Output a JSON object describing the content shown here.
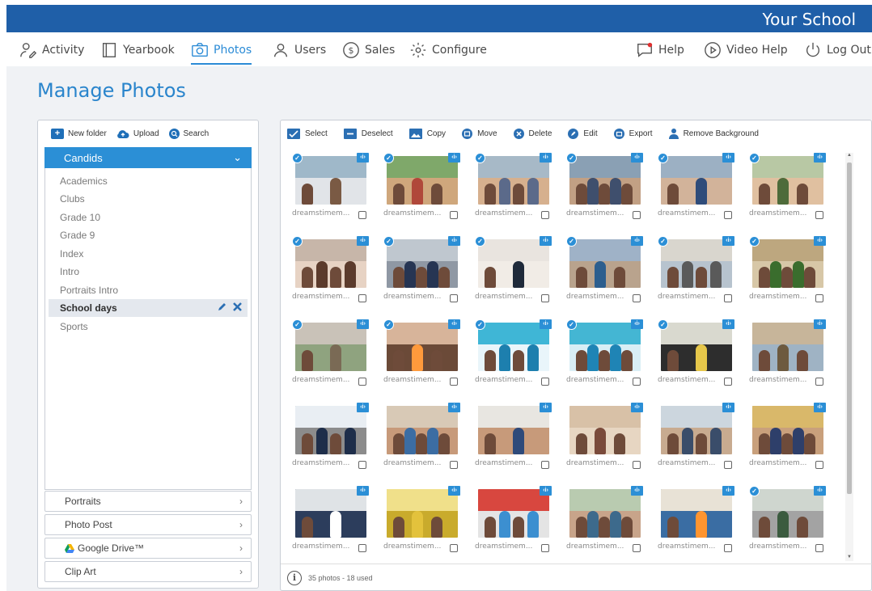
{
  "header": {
    "school_name": "Your School"
  },
  "nav": {
    "activity": "Activity",
    "yearbook": "Yearbook",
    "photos": "Photos",
    "users": "Users",
    "sales": "Sales",
    "configure": "Configure",
    "help": "Help",
    "video_help": "Video Help",
    "log_out": "Log Out"
  },
  "page": {
    "title": "Manage Photos"
  },
  "left_toolbar": {
    "new_folder": "New folder",
    "upload": "Upload",
    "search": "Search"
  },
  "folders": {
    "open_group": "Candids",
    "items": [
      "Academics",
      "Clubs",
      "Grade 10",
      "Grade 9",
      "Index",
      "Intro",
      "Portraits Intro",
      "School days",
      "Sports"
    ],
    "selected": "School days",
    "other_groups": [
      "Portraits",
      "Photo Post",
      "Google Drive™",
      "Clip Art"
    ]
  },
  "right_toolbar": {
    "select": "Select",
    "deselect": "Deselect",
    "copy": "Copy",
    "move": "Move",
    "delete": "Delete",
    "edit": "Edit",
    "export": "Export",
    "remove_background": "Remove Background"
  },
  "photos": {
    "caption": "dreamstimem...",
    "used_flags": [
      true,
      true,
      true,
      true,
      true,
      true,
      true,
      true,
      true,
      true,
      true,
      true,
      true,
      true,
      true,
      true,
      true,
      false,
      false,
      false,
      false,
      false,
      false,
      false,
      false,
      false,
      false,
      false,
      false,
      true
    ]
  },
  "footer": {
    "summary": "35 photos - 18 used"
  },
  "colors": {
    "brand_blue": "#1f5fa8",
    "accent_blue": "#2b8fd6"
  }
}
